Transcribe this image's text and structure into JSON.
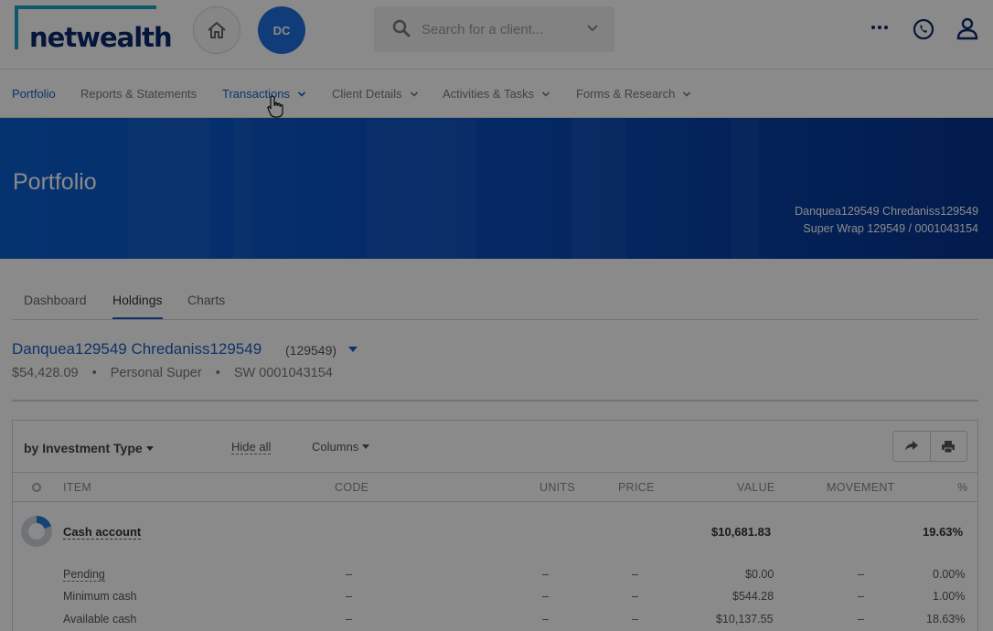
{
  "brand": {
    "name": "netwealth",
    "accent": "#1aa3c4",
    "navy": "#0a2a6b",
    "primary": "#1b5fc4"
  },
  "header": {
    "avatar_initials": "DC",
    "search_placeholder": "Search for a client...",
    "icons": [
      "home-icon",
      "search-icon",
      "chevron-down-icon",
      "more-icon",
      "phone-icon",
      "user-icon"
    ]
  },
  "nav": {
    "items": [
      {
        "label": "Portfolio"
      },
      {
        "label": "Reports & Statements"
      },
      {
        "label": "Transactions"
      },
      {
        "label": "Client Details"
      },
      {
        "label": "Activities & Tasks"
      },
      {
        "label": "Forms & Research"
      }
    ]
  },
  "banner": {
    "title": "Portfolio",
    "client_name": "Danquea129549 Chredaniss129549",
    "account": "Super Wrap 129549 / 0001043154"
  },
  "tabs": [
    "Dashboard",
    "Holdings",
    "Charts"
  ],
  "client": {
    "name": "Danquea129549 Chredaniss129549",
    "id": "(129549)",
    "balance": "$54,428.09",
    "product": "Personal Super",
    "account": "SW 0001043154",
    "separator": "•"
  },
  "holdings": {
    "group_by": "by Investment Type",
    "hide_all": "Hide all",
    "columns": "Columns",
    "headers": {
      "item": "ITEM",
      "code": "CODE",
      "units": "UNITS",
      "price": "PRICE",
      "value": "VALUE",
      "movement": "MOVEMENT",
      "pct": "%"
    },
    "group": {
      "label": "Cash account",
      "value": "$10,681.83",
      "pct": "19.63%",
      "donut_fraction": 0.1963
    },
    "rows": [
      {
        "label": "Pending",
        "code": "–",
        "units": "–",
        "price": "–",
        "value": "$0.00",
        "movement": "–",
        "pct": "0.00%"
      },
      {
        "label": "Minimum cash",
        "code": "–",
        "units": "–",
        "price": "–",
        "value": "$544.28",
        "movement": "–",
        "pct": "1.00%"
      },
      {
        "label": "Available cash",
        "code": "–",
        "units": "–",
        "price": "–",
        "value": "$10,137.55",
        "movement": "–",
        "pct": "18.63%"
      }
    ]
  }
}
